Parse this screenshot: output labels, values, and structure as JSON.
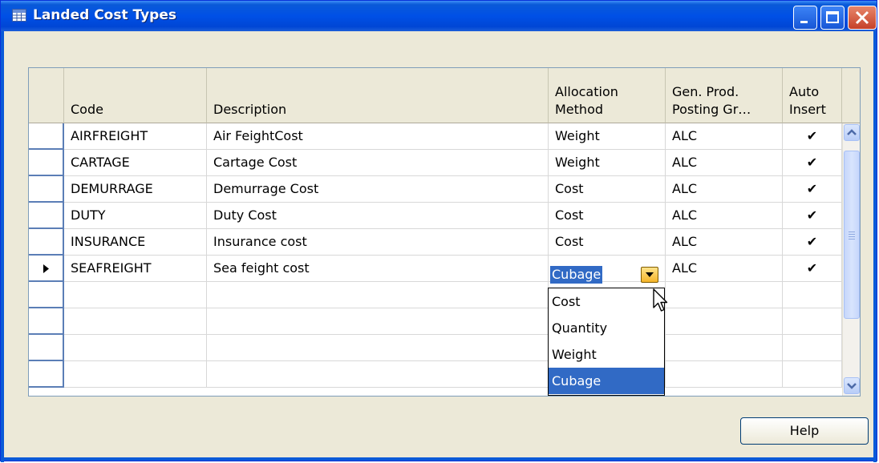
{
  "window": {
    "title": "Landed Cost Types"
  },
  "grid": {
    "columns": [
      "Code",
      "Description",
      "Allocation\nMethod",
      "Gen. Prod.\nPosting Gr…",
      "Auto\nInsert"
    ],
    "rows": [
      {
        "code": "AIRFREIGHT",
        "description": "Air FeightCost",
        "method": "Weight",
        "group": "ALC",
        "auto_insert": true
      },
      {
        "code": "CARTAGE",
        "description": "Cartage Cost",
        "method": "Weight",
        "group": "ALC",
        "auto_insert": true
      },
      {
        "code": "DEMURRAGE",
        "description": "Demurrage Cost",
        "method": "Cost",
        "group": "ALC",
        "auto_insert": true
      },
      {
        "code": "DUTY",
        "description": "Duty Cost",
        "method": "Cost",
        "group": "ALC",
        "auto_insert": true
      },
      {
        "code": "INSURANCE",
        "description": "Insurance cost",
        "method": "Cost",
        "group": "ALC",
        "auto_insert": true
      },
      {
        "code": "SEAFREIGHT",
        "description": "Sea feight cost",
        "method": "Cubage",
        "group": "ALC",
        "auto_insert": true
      }
    ],
    "empty_rows": 4,
    "current_row": 5,
    "check_mark": "✔"
  },
  "dropdown": {
    "current_value": "Cubage",
    "options": [
      "Cost",
      "Quantity",
      "Weight",
      "Cubage"
    ],
    "highlighted": "Cubage"
  },
  "buttons": {
    "help": "Help"
  },
  "colors": {
    "titlebar": "#0050e6",
    "selection": "#316ac5",
    "dialog_bg": "#ece9d8"
  }
}
